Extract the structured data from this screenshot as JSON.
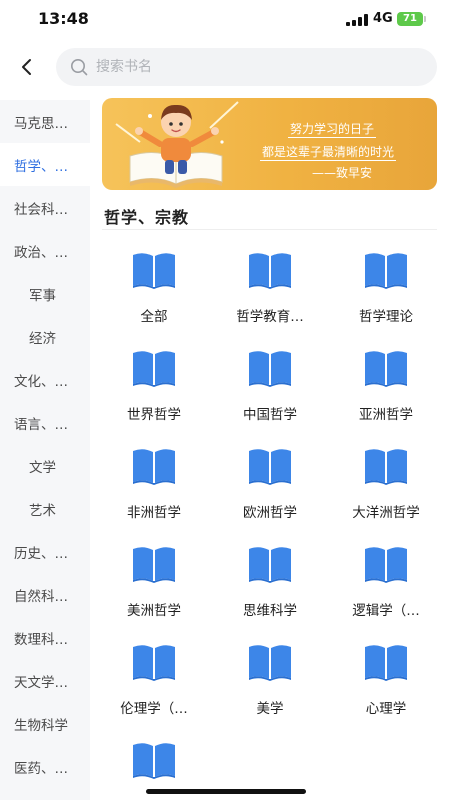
{
  "status_bar": {
    "time": "13:48",
    "network": "4G",
    "battery": "71"
  },
  "search": {
    "placeholder": "搜索书名"
  },
  "sidebar": {
    "items": [
      {
        "label": "马克思…",
        "level": 0,
        "active": false
      },
      {
        "label": "哲学、…",
        "level": 0,
        "active": true
      },
      {
        "label": "社会科…",
        "level": 0,
        "active": false
      },
      {
        "label": "政治、…",
        "level": 0,
        "active": false
      },
      {
        "label": "军事",
        "level": 1,
        "active": false
      },
      {
        "label": "经济",
        "level": 1,
        "active": false
      },
      {
        "label": "文化、…",
        "level": 0,
        "active": false
      },
      {
        "label": "语言、…",
        "level": 0,
        "active": false
      },
      {
        "label": "文学",
        "level": 1,
        "active": false
      },
      {
        "label": "艺术",
        "level": 1,
        "active": false
      },
      {
        "label": "历史、…",
        "level": 0,
        "active": false
      },
      {
        "label": "自然科…",
        "level": 0,
        "active": false
      },
      {
        "label": "数理科…",
        "level": 0,
        "active": false
      },
      {
        "label": "天文学…",
        "level": 0,
        "active": false
      },
      {
        "label": "生物科学",
        "level": 0,
        "active": false
      },
      {
        "label": "医药、…",
        "level": 0,
        "active": false
      }
    ]
  },
  "banner": {
    "line1": "努力学习的日子",
    "line2": "都是这辈子最清晰的时光",
    "line3": "——致早安"
  },
  "section": {
    "title": "哲学、宗教"
  },
  "categories": [
    {
      "label": "全部"
    },
    {
      "label": "哲学教育…"
    },
    {
      "label": "哲学理论"
    },
    {
      "label": "世界哲学"
    },
    {
      "label": "中国哲学"
    },
    {
      "label": "亚洲哲学"
    },
    {
      "label": "非洲哲学"
    },
    {
      "label": "欧洲哲学"
    },
    {
      "label": "大洋洲哲学"
    },
    {
      "label": "美洲哲学"
    },
    {
      "label": "思维科学"
    },
    {
      "label": "逻辑学（…"
    },
    {
      "label": "伦理学（…"
    },
    {
      "label": "美学"
    },
    {
      "label": "心理学"
    },
    {
      "label": ""
    }
  ],
  "colors": {
    "accent": "#2f6fe0",
    "book_icon": "#3d86e8",
    "banner": "#f0b242"
  }
}
